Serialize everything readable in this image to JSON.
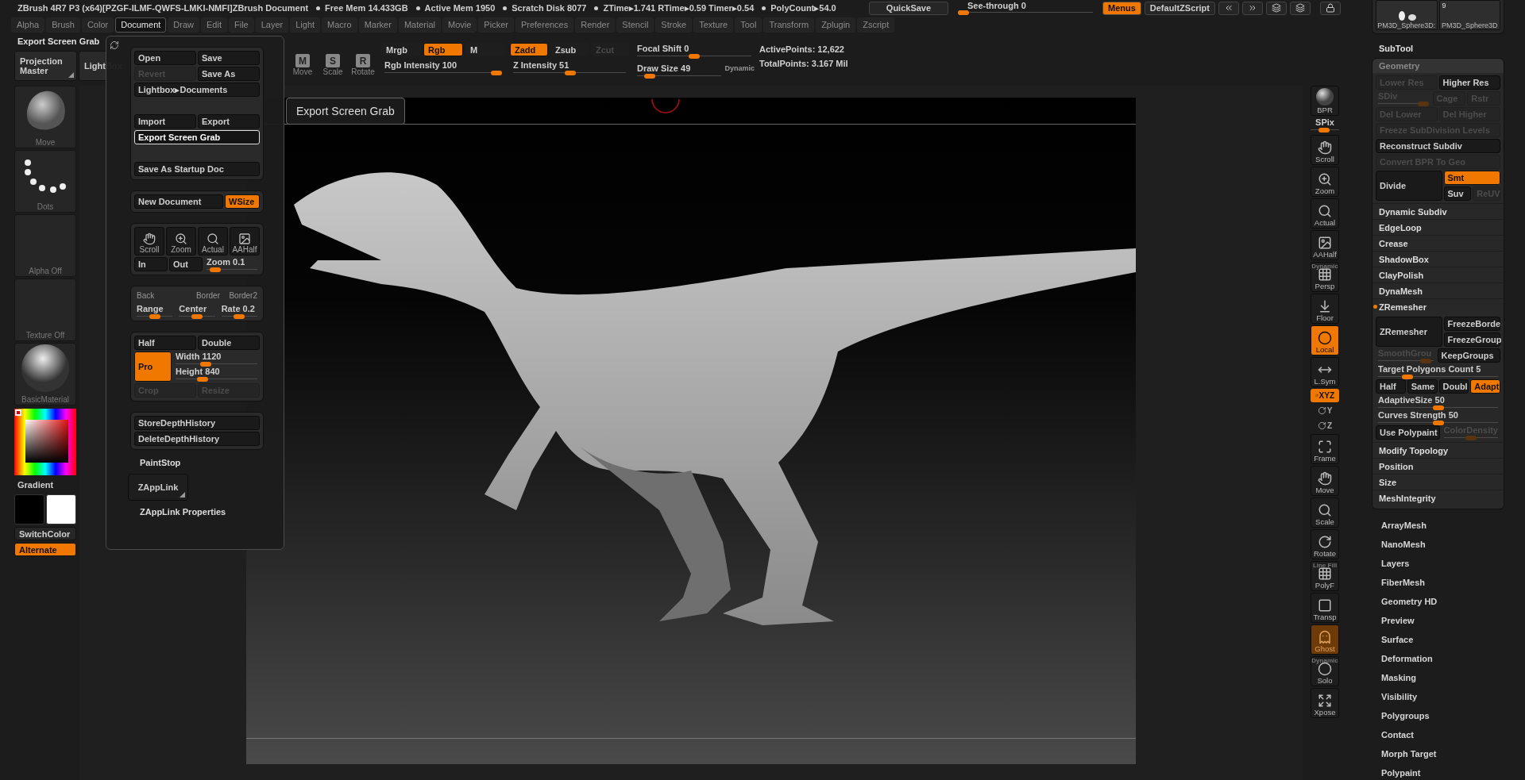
{
  "title_bar": {
    "title": "ZBrush 4R7 P3 (x64)[PZGF-ILMF-QWFS-LMKI-NMFI]ZBrush Document",
    "stats": [
      "Free Mem 14.433GB",
      "Active Mem 1950",
      "Scratch Disk 8077",
      "ZTime▸1.741 RTime▸0.59 Timer▸0.54",
      "PolyCount▸54.0"
    ],
    "quicksave": "QuickSave",
    "see_through": {
      "label": "See-through",
      "value": "0",
      "level": 0
    },
    "menus": {
      "label": "Menus",
      "on": true
    },
    "default_zscript": "DefaultZScript"
  },
  "menu_bar": [
    {
      "label": "Alpha",
      "selected": false
    },
    {
      "label": "Brush",
      "selected": false
    },
    {
      "label": "Color",
      "selected": false
    },
    {
      "label": "Document",
      "selected": true
    },
    {
      "label": "Draw",
      "selected": false
    },
    {
      "label": "Edit",
      "selected": false
    },
    {
      "label": "File",
      "selected": false
    },
    {
      "label": "Layer",
      "selected": false
    },
    {
      "label": "Light",
      "selected": false
    },
    {
      "label": "Macro",
      "selected": false
    },
    {
      "label": "Marker",
      "selected": false
    },
    {
      "label": "Material",
      "selected": false
    },
    {
      "label": "Movie",
      "selected": false
    },
    {
      "label": "Picker",
      "selected": false
    },
    {
      "label": "Preferences",
      "selected": false
    },
    {
      "label": "Render",
      "selected": false
    },
    {
      "label": "Stencil",
      "selected": false
    },
    {
      "label": "Stroke",
      "selected": false
    },
    {
      "label": "Texture",
      "selected": false
    },
    {
      "label": "Tool",
      "selected": false
    },
    {
      "label": "Transform",
      "selected": false
    },
    {
      "label": "Zplugin",
      "selected": false
    },
    {
      "label": "Zscript",
      "selected": false
    }
  ],
  "shelf": {
    "current_tool": "Export Screen Grab",
    "projection_master": "Projection Master",
    "lightbox": "LightBox",
    "transform": [
      {
        "key": "M",
        "label": "Move"
      },
      {
        "key": "S",
        "label": "Scale"
      },
      {
        "key": "R",
        "label": "Rotate"
      }
    ],
    "color_modes": [
      {
        "label": "Mrgb",
        "selected": false
      },
      {
        "label": "Rgb",
        "selected": true
      },
      {
        "label": "M",
        "selected": false
      }
    ],
    "z_modes": [
      {
        "label": "Zadd",
        "selected": true,
        "disabled": false
      },
      {
        "label": "Zsub",
        "selected": false,
        "disabled": false
      },
      {
        "label": "Zcut",
        "selected": false,
        "disabled": true
      }
    ],
    "sliders": [
      {
        "label": "Rgb Intensity",
        "value": "100",
        "level": 1
      },
      {
        "label": "Z Intensity",
        "value": "51",
        "level": 0.51
      },
      {
        "label": "Focal Shift",
        "value": "0",
        "level": 0.5
      },
      {
        "label": "Draw Size",
        "value": "49",
        "level": 0.1,
        "note": "Dynamic"
      }
    ],
    "points": [
      "ActivePoints: 12,622",
      "TotalPoints: 3.167 Mil"
    ]
  },
  "left_shelf": {
    "tiles": [
      {
        "kind": "brush",
        "label": "Move"
      },
      {
        "kind": "stroke",
        "label": "Dots"
      },
      {
        "kind": "empty",
        "label": "Alpha Off"
      },
      {
        "kind": "empty",
        "label": "Texture Off"
      },
      {
        "kind": "material",
        "label": "BasicMaterial"
      }
    ],
    "gradient": "Gradient",
    "swatches": [
      {
        "color": "#000000"
      },
      {
        "color": "#ffffff"
      }
    ],
    "switch_color": "SwitchColor",
    "alternate": {
      "label": "Alternate",
      "on": true
    }
  },
  "document_menu": {
    "groups": [
      {
        "rows": [
          {
            "items": [
              {
                "kind": "button",
                "label": "Open",
                "active": false,
                "disabled": false
              },
              {
                "kind": "button",
                "label": "Save",
                "active": false,
                "disabled": false
              }
            ]
          },
          {
            "items": [
              {
                "kind": "button",
                "label": "Revert",
                "active": false,
                "disabled": true
              },
              {
                "kind": "button",
                "label": "Save As",
                "active": false,
                "disabled": false
              }
            ]
          },
          {
            "items": [
              {
                "kind": "button",
                "label": "Lightbox▸Documents",
                "active": false,
                "disabled": false
              }
            ]
          },
          {
            "items": [
              {
                "kind": "button",
                "label": "Import",
                "active": false,
                "disabled": false
              },
              {
                "kind": "button",
                "label": "Export",
                "active": false,
                "disabled": false
              }
            ]
          },
          {
            "items": [
              {
                "kind": "button",
                "label": "Export Screen Grab",
                "active": false,
                "disabled": false,
                "hovered": true
              }
            ]
          },
          {
            "items": [
              {
                "kind": "button",
                "label": "Save As Startup Doc",
                "active": false,
                "disabled": false
              }
            ]
          }
        ]
      },
      {
        "rows": [
          {
            "items": [
              {
                "kind": "button",
                "label": "New Document",
                "active": false,
                "disabled": false
              },
              {
                "kind": "button",
                "label": "WSize",
                "active": true,
                "disabled": false
              }
            ]
          }
        ]
      },
      {
        "rows": [
          {
            "items": [
              {
                "kind": "icon_button",
                "label": "Scroll"
              },
              {
                "kind": "icon_button",
                "label": "Zoom"
              },
              {
                "kind": "icon_button",
                "label": "Actual"
              },
              {
                "kind": "icon_button",
                "label": "AAHalf"
              }
            ]
          },
          {
            "items": [
              {
                "kind": "button",
                "label": "In",
                "active": false,
                "disabled": false
              },
              {
                "kind": "button",
                "label": "Out",
                "active": false,
                "disabled": false
              },
              {
                "kind": "slider",
                "label": "Zoom",
                "value": "0.1",
                "level": 0.08,
                "disabled": false
              }
            ]
          }
        ]
      },
      {
        "rows": [
          {
            "items": [
              {
                "kind": "text",
                "label": "Back"
              },
              {
                "kind": "text",
                "label": "Border"
              },
              {
                "kind": "text",
                "label": "Border2"
              }
            ]
          },
          {
            "items": [
              {
                "kind": "slider",
                "label": "Range",
                "level": 0.5,
                "disabled": false
              },
              {
                "kind": "slider",
                "label": "Center",
                "level": 0.5,
                "disabled": false
              },
              {
                "kind": "slider",
                "label": "Rate",
                "value": "0.2",
                "level": 0.5,
                "disabled": false
              }
            ]
          }
        ]
      },
      {
        "rows": [
          {
            "items": [
              {
                "kind": "button",
                "label": "Half",
                "active": false,
                "disabled": false
              },
              {
                "kind": "button",
                "label": "Double",
                "active": false,
                "disabled": false
              }
            ]
          },
          {
            "items": [
              {
                "kind": "tall_button",
                "label": "Pro",
                "active": true,
                "disabled": false
              },
              {
                "kind": "column",
                "rows": [
                  {
                    "items": [
                      {
                        "kind": "slider",
                        "label": "Width",
                        "value": "1120",
                        "level": 0.35,
                        "disabled": false
                      }
                    ]
                  },
                  {
                    "items": [
                      {
                        "kind": "slider",
                        "label": "Height",
                        "value": "840",
                        "level": 0.3,
                        "disabled": false
                      }
                    ]
                  }
                ]
              }
            ]
          },
          {
            "items": [
              {
                "kind": "button",
                "label": "Crop",
                "active": false,
                "disabled": true
              },
              {
                "kind": "button",
                "label": "Resize",
                "active": false,
                "disabled": true
              }
            ]
          }
        ]
      },
      {
        "rows": [
          {
            "items": [
              {
                "kind": "button",
                "label": "StoreDepthHistory",
                "active": false,
                "disabled": false
              }
            ]
          },
          {
            "items": [
              {
                "kind": "button",
                "label": "DeleteDepthHistory",
                "active": false,
                "disabled": false
              }
            ]
          }
        ]
      }
    ],
    "paint_stop": "PaintStop",
    "zapplink": "ZAppLink",
    "zapplink_properties": "ZAppLink Properties"
  },
  "tooltip": "Export Screen Grab",
  "right_toolbar": [
    {
      "kind": "tool",
      "label": "BPR",
      "active": false,
      "disabled": false
    },
    {
      "kind": "slider",
      "label": "SPix",
      "level": 0.45
    },
    {
      "kind": "tool",
      "label": "Scroll",
      "active": false,
      "disabled": false
    },
    {
      "kind": "tool",
      "label": "Zoom",
      "active": false,
      "disabled": false
    },
    {
      "kind": "tool",
      "label": "Actual",
      "active": false,
      "disabled": false
    },
    {
      "kind": "tool",
      "label": "AAHalf",
      "active": false,
      "disabled": false
    },
    {
      "kind": "tool",
      "label": "Persp",
      "caption": "Dynamic",
      "active": false,
      "disabled": false
    },
    {
      "kind": "tool",
      "label": "Floor",
      "active": false,
      "disabled": false
    },
    {
      "kind": "tool",
      "label": "Local",
      "active": true,
      "disabled": false
    },
    {
      "kind": "tool",
      "label": "L.Sym",
      "active": false,
      "disabled": false
    },
    {
      "kind": "small",
      "label": "XYZ",
      "active": true
    },
    {
      "kind": "small",
      "label": "Y",
      "active": false
    },
    {
      "kind": "small",
      "label": "Z",
      "active": false
    },
    {
      "kind": "tool",
      "label": "Frame",
      "active": false,
      "disabled": false
    },
    {
      "kind": "tool",
      "label": "Move",
      "active": false,
      "disabled": false
    },
    {
      "kind": "tool",
      "label": "Scale",
      "active": false,
      "disabled": false
    },
    {
      "kind": "tool",
      "label": "Rotate",
      "active": false,
      "disabled": false
    },
    {
      "kind": "tool",
      "label": "PolyF",
      "caption": "Line Fill",
      "active": false,
      "disabled": false
    },
    {
      "kind": "tool",
      "label": "Transp",
      "active": false,
      "disabled": false
    },
    {
      "kind": "tool",
      "label": "Ghost",
      "active": true,
      "disabled": true
    },
    {
      "kind": "tool",
      "label": "Solo",
      "caption": "Dynamic",
      "active": false,
      "disabled": false
    },
    {
      "kind": "tool",
      "label": "Xpose",
      "active": false,
      "disabled": false
    }
  ],
  "right_panel": {
    "thumbnails": [
      {
        "label": "PM3D_Sphere3D:"
      },
      {
        "label": "PM3D_Sphere3D",
        "count": "9"
      }
    ],
    "subtool": "SubTool",
    "geometry": {
      "title": "Geometry",
      "rows": [
        {
          "items": [
            {
              "kind": "button",
              "label": "Lower Res",
              "active": false,
              "disabled": true
            },
            {
              "kind": "button",
              "label": "Higher Res",
              "active": false,
              "disabled": false
            }
          ]
        },
        {
          "items": [
            {
              "kind": "slider",
              "label": "SDiv",
              "disabled": true,
              "level": 1
            },
            {
              "kind": "button",
              "label": "Cage",
              "active": false,
              "disabled": true
            },
            {
              "kind": "button",
              "label": "Rstr",
              "active": false,
              "disabled": true
            }
          ]
        },
        {
          "items": [
            {
              "kind": "button",
              "label": "Del Lower",
              "active": false,
              "disabled": true
            },
            {
              "kind": "button",
              "label": "Del Higher",
              "active": false,
              "disabled": true
            }
          ]
        },
        {
          "items": [
            {
              "kind": "button",
              "label": "Freeze SubDivision Levels",
              "active": false,
              "disabled": true
            }
          ]
        },
        {
          "items": [
            {
              "kind": "button",
              "label": "Reconstruct Subdiv",
              "active": false,
              "disabled": false
            }
          ]
        },
        {
          "items": [
            {
              "kind": "button",
              "label": "Convert BPR To Geo",
              "active": false,
              "disabled": true
            }
          ]
        },
        {
          "items": [
            {
              "kind": "tall_button",
              "label": "Divide",
              "active": false,
              "disabled": false
            },
            {
              "kind": "column",
              "rows": [
                {
                  "items": [
                    {
                      "kind": "button",
                      "label": "Smt",
                      "active": true,
                      "disabled": false
                    }
                  ]
                },
                {
                  "items": [
                    {
                      "kind": "button",
                      "label": "Suv",
                      "active": false,
                      "disabled": false
                    },
                    {
                      "kind": "button",
                      "label": "ReUV",
                      "active": false,
                      "disabled": true
                    }
                  ]
                }
              ]
            }
          ]
        }
      ],
      "sections": [
        {
          "label": "Dynamic Subdiv",
          "expanded": false
        },
        {
          "label": "EdgeLoop",
          "expanded": false
        },
        {
          "label": "Crease",
          "expanded": false
        },
        {
          "label": "ShadowBox",
          "expanded": false
        },
        {
          "label": "ClayPolish",
          "expanded": false
        },
        {
          "label": "DynaMesh",
          "expanded": false
        },
        {
          "label": "ZRemesher",
          "expanded": true,
          "rows": [
            {
              "items": [
                {
                  "kind": "tall_button",
                  "label": "ZRemesher",
                  "active": false,
                  "disabled": false
                },
                {
                  "kind": "column",
                  "rows": [
                    {
                      "items": [
                        {
                          "kind": "button",
                          "label": "FreezeBorde",
                          "active": false,
                          "disabled": false
                        }
                      ]
                    },
                    {
                      "items": [
                        {
                          "kind": "button",
                          "label": "FreezeGroup",
                          "active": false,
                          "disabled": false
                        }
                      ]
                    }
                  ]
                }
              ]
            },
            {
              "items": [
                {
                  "kind": "slider",
                  "label": "SmoothGrou",
                  "disabled": true,
                  "level": 0.95
                },
                {
                  "kind": "button",
                  "label": "KeepGroups",
                  "active": false,
                  "disabled": false
                }
              ]
            },
            {
              "items": [
                {
                  "kind": "slider",
                  "label": "Target Polygons Count",
                  "value": "5",
                  "level": 0.22,
                  "disabled": false
                }
              ]
            },
            {
              "items": [
                {
                  "kind": "button",
                  "label": "Half",
                  "active": false,
                  "disabled": false
                },
                {
                  "kind": "button",
                  "label": "Same",
                  "active": false,
                  "disabled": false
                },
                {
                  "kind": "button",
                  "label": "Doubl",
                  "active": false,
                  "disabled": false
                },
                {
                  "kind": "button",
                  "label": "Adapt",
                  "active": true,
                  "disabled": false
                }
              ]
            },
            {
              "items": [
                {
                  "kind": "slider",
                  "label": "AdaptiveSize",
                  "value": "50",
                  "level": 0.5,
                  "disabled": false
                }
              ]
            },
            {
              "items": [
                {
                  "kind": "slider",
                  "label": "Curves Strength",
                  "value": "50",
                  "level": 0.5,
                  "disabled": false
                }
              ]
            },
            {
              "items": [
                {
                  "kind": "button",
                  "label": "Use Polypaint",
                  "active": false,
                  "disabled": false
                },
                {
                  "kind": "slider",
                  "label": "ColorDensity",
                  "disabled": true,
                  "level": 0.5
                }
              ]
            }
          ]
        },
        {
          "label": "Modify Topology",
          "expanded": false
        },
        {
          "label": "Position",
          "expanded": false
        },
        {
          "label": "Size",
          "expanded": false
        },
        {
          "label": "MeshIntegrity",
          "expanded": false
        }
      ]
    },
    "palettes": [
      "ArrayMesh",
      "NanoMesh",
      "Layers",
      "FiberMesh",
      "Geometry HD",
      "Preview",
      "Surface",
      "Deformation",
      "Masking",
      "Visibility",
      "Polygroups",
      "Contact",
      "Morph Target",
      "Polypaint"
    ]
  }
}
